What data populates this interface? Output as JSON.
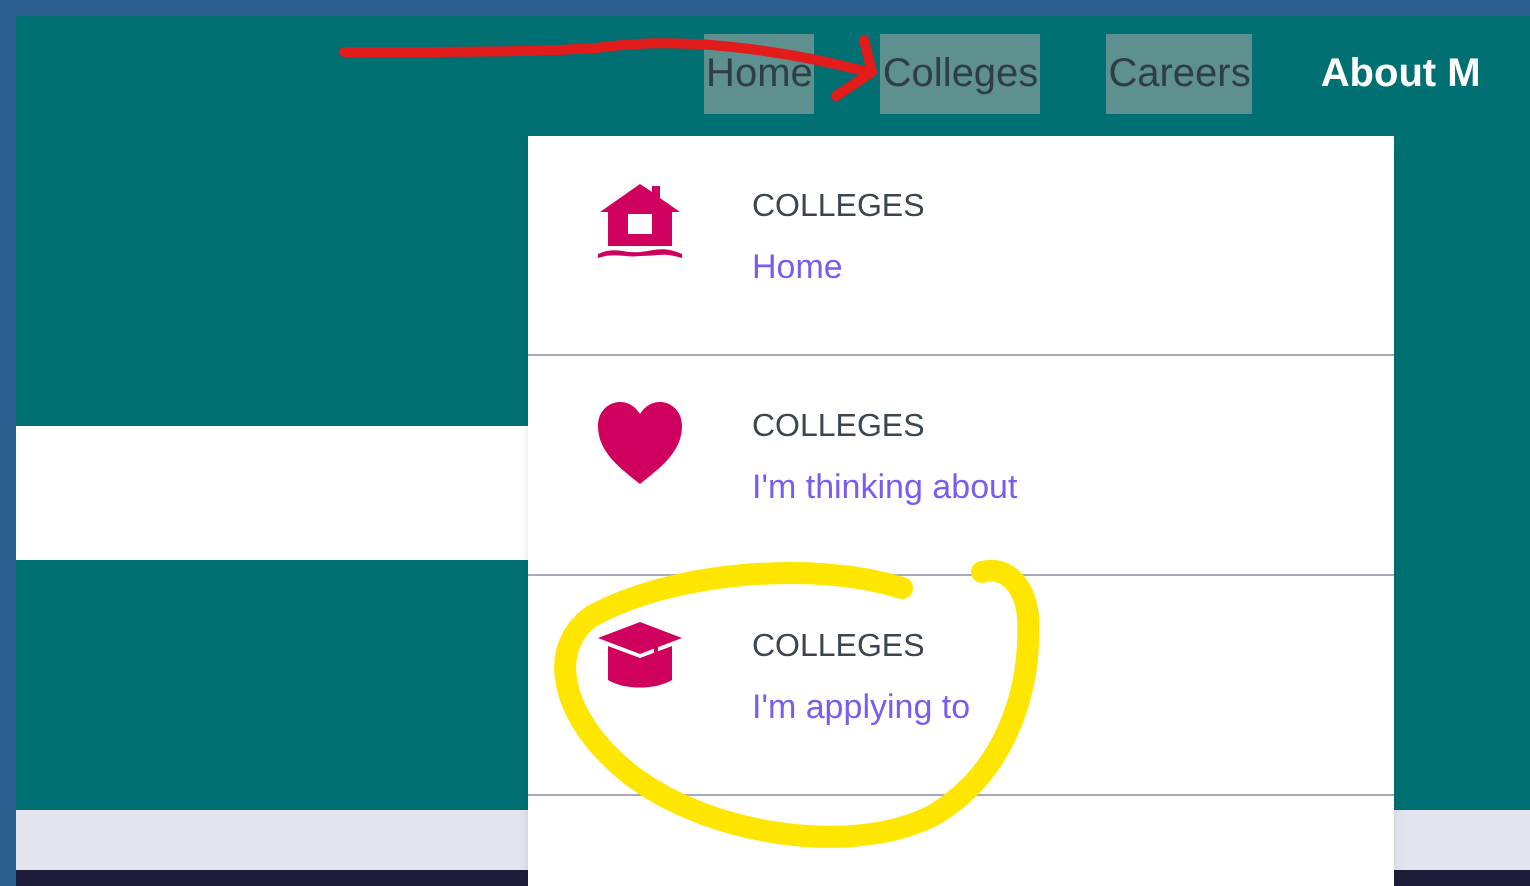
{
  "nav": [
    {
      "label": "Home",
      "highlighted": true
    },
    {
      "label": "Colleges",
      "highlighted": true
    },
    {
      "label": "Careers",
      "highlighted": true
    },
    {
      "label": "About M",
      "highlighted": false
    }
  ],
  "dropdown": {
    "items": [
      {
        "kind": "house",
        "category": "COLLEGES",
        "link": "Home"
      },
      {
        "kind": "heart",
        "category": "COLLEGES",
        "link": "I'm thinking about"
      },
      {
        "kind": "cap",
        "category": "COLLEGES",
        "link": "I'm applying to"
      }
    ]
  }
}
